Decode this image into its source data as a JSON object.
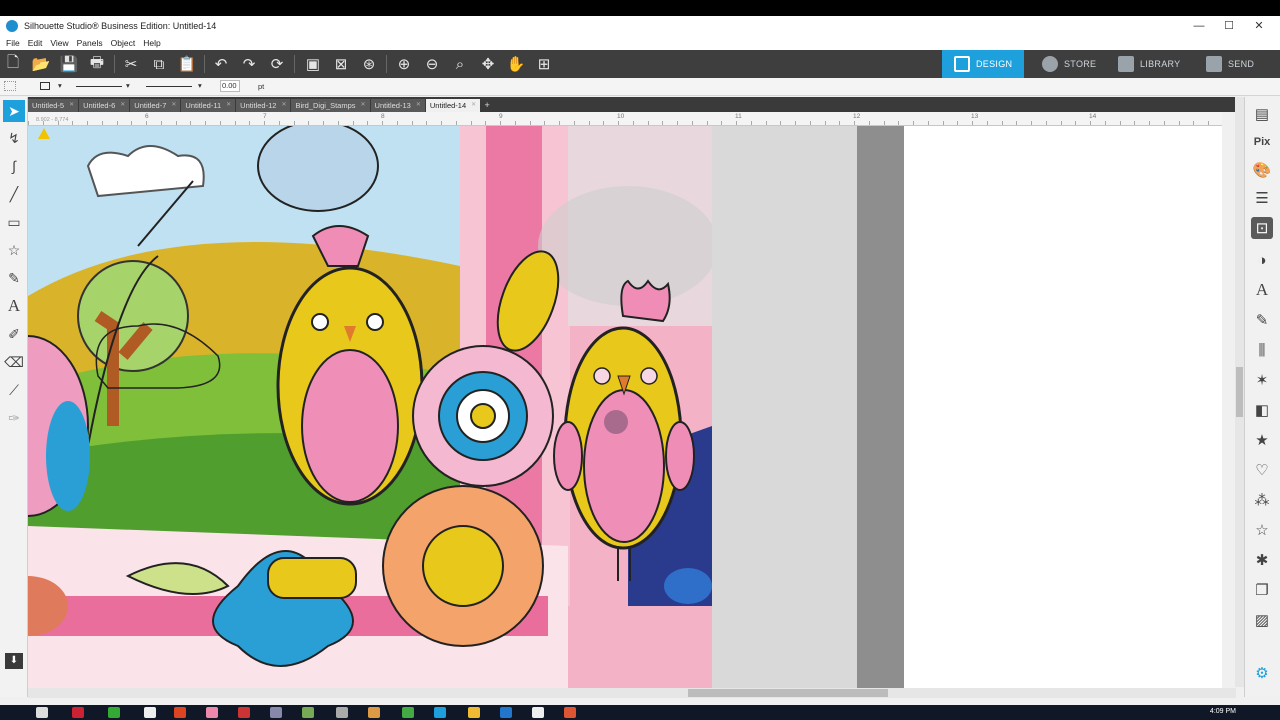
{
  "window": {
    "title": "Silhouette Studio® Business Edition: Untitled-14"
  },
  "menu": [
    "File",
    "Edit",
    "View",
    "Panels",
    "Object",
    "Help"
  ],
  "nav_tabs": [
    {
      "label": "DESIGN",
      "active": true
    },
    {
      "label": "STORE",
      "active": false
    },
    {
      "label": "LIBRARY",
      "active": false
    },
    {
      "label": "SEND",
      "active": false
    }
  ],
  "stylebar": {
    "line_width": "0.00",
    "unit": "pt"
  },
  "doc_tabs": [
    "Untitled-5",
    "Untitled-6",
    "Untitled-7",
    "Untitled-11",
    "Untitled-12",
    "Bird_Digi_Stamps",
    "Untitled-13",
    "Untitled-14"
  ],
  "active_tab": "Untitled-14",
  "ruler": {
    "labels": [
      "6",
      "7",
      "8",
      "9",
      "10",
      "11",
      "12",
      "13",
      "14"
    ]
  },
  "selection_dims": "8.902 - 8.774",
  "taskbar": {
    "clock": "4:09 PM"
  },
  "colors": {
    "accent": "#1ea0dc",
    "toolbar": "#3e3e3e",
    "chick_yellow": "#e8c81a",
    "belly_pink": "#ef8fb8"
  }
}
